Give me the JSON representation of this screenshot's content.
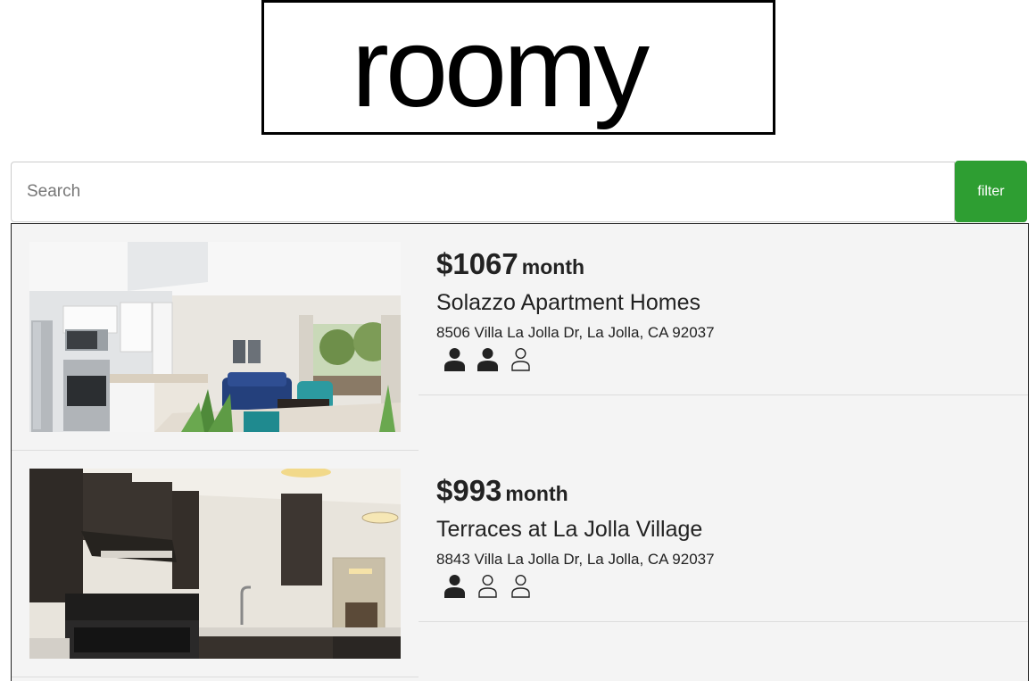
{
  "brand": {
    "logo_text": "roomy"
  },
  "search": {
    "placeholder": "Search",
    "value": "",
    "filter_label": "filter"
  },
  "colors": {
    "accent": "#2e9e32",
    "panel_bg": "#f4f4f4"
  },
  "listings": [
    {
      "price": "$1067",
      "period": "month",
      "name": "Solazzo Apartment Homes",
      "address": "8506 Villa La Jolla Dr, La Jolla, CA 92037",
      "photo_icon": "living-room-kitchen-photo",
      "occupancy": {
        "filled": 2,
        "total": 3
      }
    },
    {
      "price": "$993",
      "period": "month",
      "name": "Terraces at La Jolla Village",
      "address": "8843 Villa La Jolla Dr, La Jolla, CA 92037",
      "photo_icon": "kitchen-photo",
      "occupancy": {
        "filled": 1,
        "total": 3
      }
    }
  ]
}
